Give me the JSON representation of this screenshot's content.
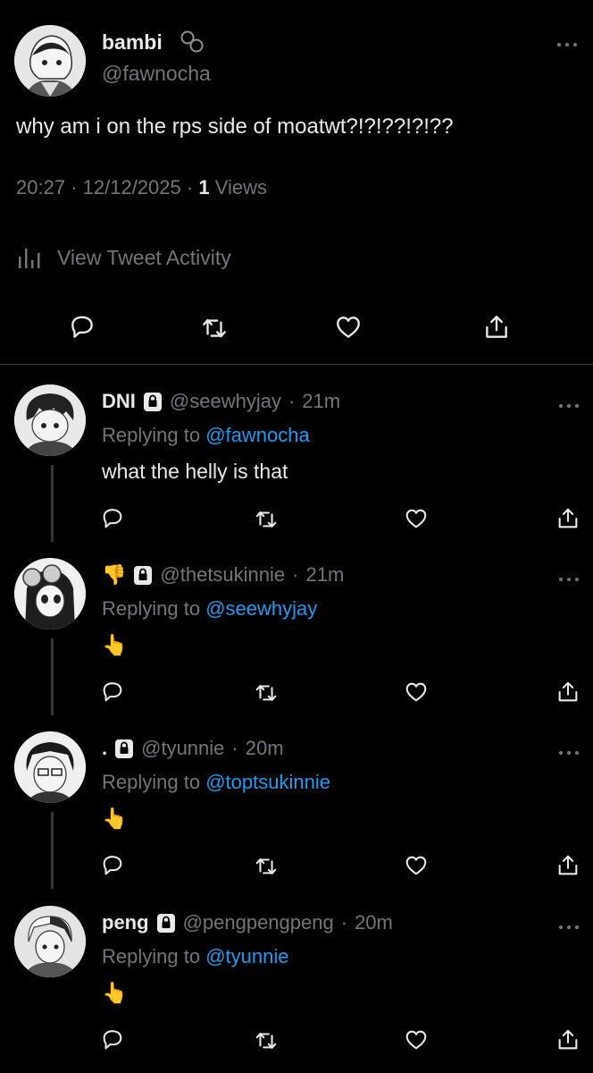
{
  "main_tweet": {
    "author_name": "bambi",
    "author_handle": "@fawnocha",
    "text": "why am i on the rps side of moatwt?!?!??!?!??",
    "time": "20:27",
    "date": "12/12/2025",
    "views_count": "1",
    "views_label": "Views",
    "activity_label": "View Tweet Activity"
  },
  "replies": [
    {
      "name": "DNI",
      "handle": "@seewhyjay",
      "time": "21m",
      "replying_prefix": "Replying to",
      "replying_to": "@fawnocha",
      "text": "what the helly is that"
    },
    {
      "name": "👎",
      "handle": "@thetsukinnie",
      "time": "21m",
      "replying_prefix": "Replying to",
      "replying_to": "@seewhyjay",
      "text": "👆"
    },
    {
      "name": ".",
      "handle": "@tyunnie",
      "time": "20m",
      "replying_prefix": "Replying to",
      "replying_to": "@toptsukinnie",
      "text": "👆"
    },
    {
      "name": "peng",
      "handle": "@pengpengpeng",
      "time": "20m",
      "replying_prefix": "Replying to",
      "replying_to": "@tyunnie",
      "text": "👆"
    }
  ],
  "colors": {
    "background": "#000000",
    "text": "#e7e9ea",
    "muted": "#71767b",
    "link": "#1d9bf0",
    "divider": "#2f3336"
  },
  "icons": [
    "more-icon",
    "reply-icon",
    "retweet-icon",
    "like-icon",
    "share-icon",
    "lock-icon",
    "analytics-icon",
    "badge-icon"
  ]
}
